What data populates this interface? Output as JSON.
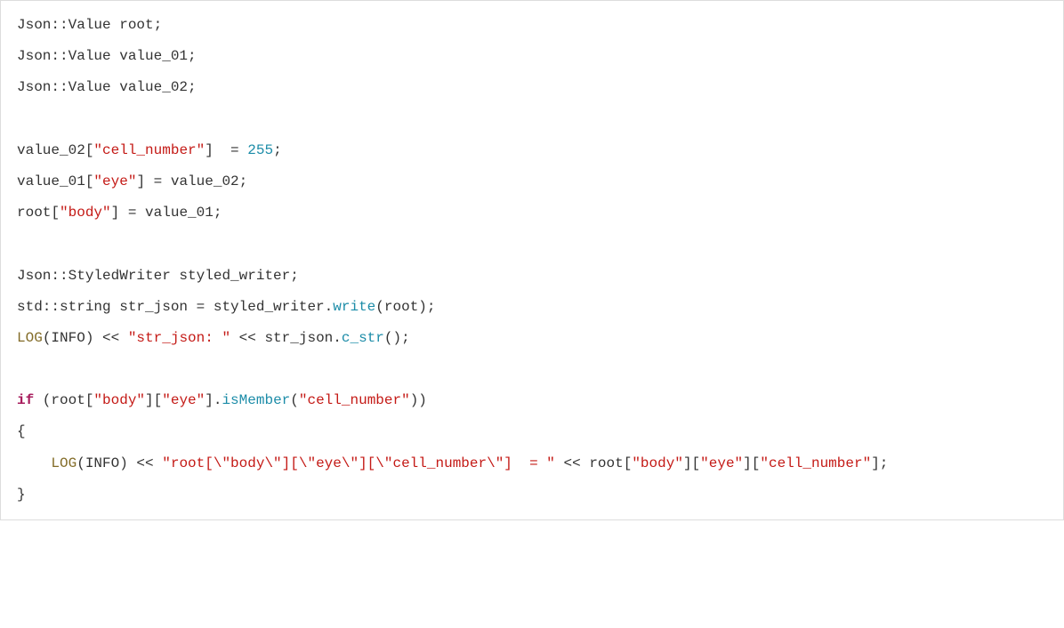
{
  "code": {
    "colors": {
      "plain": "#333333",
      "string": "#c41a16",
      "number": "#1c8ca8",
      "method": "#1c8ca8",
      "keyword": "#a71d5d",
      "func": "#836c28"
    },
    "tokens": {
      "l1_a": "Json::Value root;",
      "l2_a": "Json::Value value_01;",
      "l3_a": "Json::Value value_02;",
      "l5_a": "value_02[",
      "l5_b": "\"cell_number\"",
      "l5_c": "]  = ",
      "l5_d": "255",
      "l5_e": ";",
      "l6_a": "value_01[",
      "l6_b": "\"eye\"",
      "l6_c": "] = value_02;",
      "l7_a": "root[",
      "l7_b": "\"body\"",
      "l7_c": "] = value_01;",
      "l9_a": "Json::StyledWriter styled_writer;",
      "l10_a": "std::string str_json = styled_writer.",
      "l10_b": "write",
      "l10_c": "(root);",
      "l11_a": "LOG",
      "l11_b": "(INFO) << ",
      "l11_c": "\"str_json: \"",
      "l11_d": " << str_json.",
      "l11_e": "c_str",
      "l11_f": "();",
      "l13_a": "if",
      "l13_b": " (root[",
      "l13_c": "\"body\"",
      "l13_d": "][",
      "l13_e": "\"eye\"",
      "l13_f": "].",
      "l13_g": "isMember",
      "l13_h": "(",
      "l13_i": "\"cell_number\"",
      "l13_j": "))",
      "l14_a": "{",
      "l15_a": "    ",
      "l15_b": "LOG",
      "l15_c": "(INFO) << ",
      "l15_d": "\"root[\\\"body\\\"][\\\"eye\\\"][\\\"cell_number\\\"]  = \"",
      "l15_e": " << root[",
      "l15_f": "\"body\"",
      "l15_g": "][",
      "l15_h": "\"eye\"",
      "l15_i": "][",
      "l15_j": "\"cell_number\"",
      "l15_k": "];",
      "l16_a": "}"
    }
  }
}
